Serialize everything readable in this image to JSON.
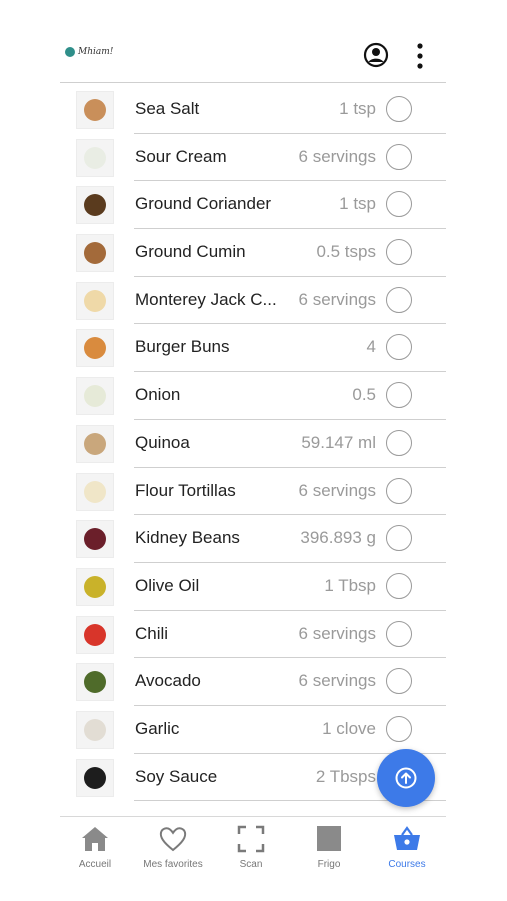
{
  "header": {
    "logo_text": "Mhiam!"
  },
  "items": [
    {
      "name": "Sea Salt",
      "qty": "1 tsp",
      "color": "#c98f5a"
    },
    {
      "name": "Sour Cream",
      "qty": "6 servings",
      "color": "#e9ede4"
    },
    {
      "name": "Ground Coriander",
      "qty": "1 tsp",
      "color": "#5a3b1e"
    },
    {
      "name": "Ground Cumin",
      "qty": "0.5 tsps",
      "color": "#a36a3a"
    },
    {
      "name": "Monterey Jack C...",
      "qty": "6 servings",
      "color": "#efd9a8"
    },
    {
      "name": "Burger Buns",
      "qty": "4",
      "color": "#d98b3e"
    },
    {
      "name": "Onion",
      "qty": "0.5",
      "color": "#e6ead8"
    },
    {
      "name": "Quinoa",
      "qty": "59.147 ml",
      "color": "#c9a77c"
    },
    {
      "name": "Flour Tortillas",
      "qty": "6 servings",
      "color": "#f0e6c8"
    },
    {
      "name": "Kidney Beans",
      "qty": "396.893 g",
      "color": "#6b1f2a"
    },
    {
      "name": "Olive Oil",
      "qty": "1 Tbsp",
      "color": "#c9b22a"
    },
    {
      "name": "Chili",
      "qty": "6 servings",
      "color": "#d8352a"
    },
    {
      "name": "Avocado",
      "qty": "6 servings",
      "color": "#4f6b2a"
    },
    {
      "name": "Garlic",
      "qty": "1 clove",
      "color": "#e2ddd4"
    },
    {
      "name": "Soy Sauce",
      "qty": "2 Tbsps",
      "color": "#1d1d1d"
    }
  ],
  "nav": [
    {
      "label": "Accueil",
      "icon": "home-icon"
    },
    {
      "label": "Mes favorites",
      "icon": "heart-icon"
    },
    {
      "label": "Scan",
      "icon": "scan-icon"
    },
    {
      "label": "Frigo",
      "icon": "fridge-icon"
    },
    {
      "label": "Courses",
      "icon": "basket-icon"
    }
  ],
  "colors": {
    "accent": "#3d7ae8",
    "separator": "#cfcfcf",
    "muted": "#9a9a9a"
  }
}
